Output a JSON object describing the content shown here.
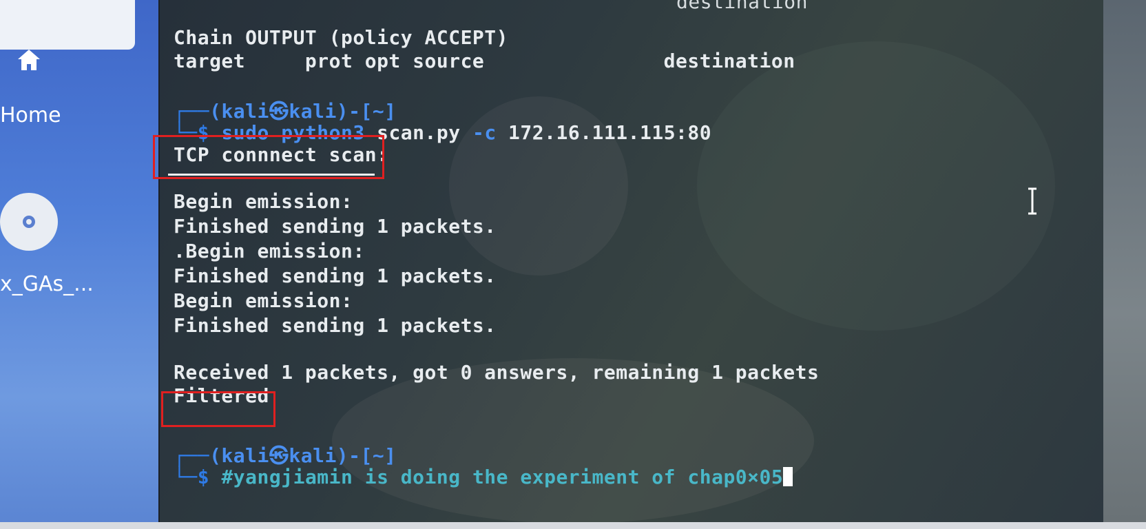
{
  "desktop": {
    "items": [
      {
        "label": "Home",
        "icon": "home-icon"
      },
      {
        "label": "x_GAs_...",
        "icon": "disc-icon"
      }
    ]
  },
  "terminal": {
    "lines": {
      "truncated_header": "destination",
      "chain_output": "Chain OUTPUT (policy ACCEPT)",
      "table_header": "target     prot opt source               destination",
      "prompt1_user": "(kali㉿kali)-[~]",
      "prompt1_cmd_a": "sudo python3",
      "prompt1_cmd_b": "scan.py",
      "prompt1_cmd_c": "-c",
      "prompt1_cmd_d": "172.16.111.115:80",
      "tcp_scan": "TCP connnect scan:",
      "begin1": "Begin emission:",
      "finished1": "Finished sending 1 packets.",
      "begin2": ".Begin emission:",
      "finished2": "Finished sending 1 packets.",
      "begin3": "Begin emission:",
      "finished3": "Finished sending 1 packets.",
      "received": "Received 1 packets, got 0 answers, remaining 1 packets",
      "filtered": "Filtered",
      "prompt2_user": "(kali㉿kali)-[~]",
      "prompt2_cmd": "#yangjiamin is doing the experiment of chap0×05"
    },
    "colors": {
      "prompt": "#2f7be6",
      "comment": "#49b7c8",
      "highlight_box": "#e02020"
    }
  }
}
